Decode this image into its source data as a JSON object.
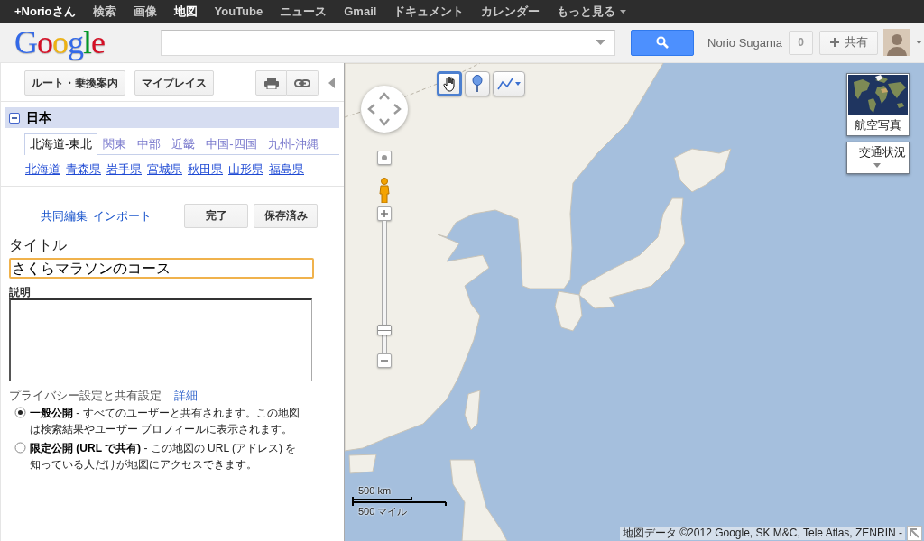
{
  "top_bar": {
    "profile_link": "+Norioさん",
    "items": [
      {
        "label": "検索",
        "selected": false
      },
      {
        "label": "画像",
        "selected": false
      },
      {
        "label": "地図",
        "selected": true
      },
      {
        "label": "YouTube",
        "selected": false
      },
      {
        "label": "ニュース",
        "selected": false
      },
      {
        "label": "Gmail",
        "selected": false
      },
      {
        "label": "ドキュメント",
        "selected": false
      },
      {
        "label": "カレンダー",
        "selected": false
      }
    ],
    "more_menu": "もっと見る"
  },
  "header": {
    "logo": "Google",
    "account": {
      "name": "Norio Sugama",
      "notification_count": "0",
      "share_button": "共有"
    }
  },
  "left_panel": {
    "buttons": [
      "ルート・乗換案内",
      "マイプレイス"
    ],
    "region": {
      "title": "日本",
      "expanded": true,
      "tabs": [
        {
          "label": "北海道-東北",
          "selected": true
        },
        {
          "label": "関東",
          "selected": false
        },
        {
          "label": "中部",
          "selected": false
        },
        {
          "label": "近畿",
          "selected": false
        },
        {
          "label": "中国-四国",
          "selected": false
        },
        {
          "label": "九州-沖縄",
          "selected": false
        }
      ],
      "prefectures": [
        "北海道",
        "青森県",
        "岩手県",
        "宮城県",
        "秋田県",
        "山形県",
        "福島県"
      ]
    },
    "edit": {
      "links": [
        "共同編集",
        "インポート"
      ],
      "buttons": [
        "完了",
        "保存済み"
      ],
      "title_label": "タイトル",
      "title_value": "さくらマラソンのコース",
      "description_label": "説明",
      "privacy_label": "プライバシー設定と共有設定",
      "privacy_link": "詳細",
      "privacy_options": [
        {
          "text": "**一般公開** - すべてのユーザーと共有されます。この地図は検索結果やユーザー プロフィールに表示されます。",
          "selected": true
        },
        {
          "text": "**限定公開 (URL で共有)** - この地図の URL (アドレス) を知っている人だけが地図にアクセスできます。",
          "selected": false
        }
      ]
    }
  },
  "map": {
    "tools": [
      {
        "kind": "hand",
        "selected": true
      },
      {
        "kind": "marker",
        "selected": false
      },
      {
        "kind": "line",
        "selected": false
      }
    ],
    "zoom": {
      "level": 0.15
    },
    "layers": [
      {
        "kind": "satellite",
        "label": "航空写真"
      },
      {
        "kind": "traffic",
        "label": "交通状況"
      }
    ],
    "scale": {
      "metric": "500 km",
      "imperial": "500 マイル"
    },
    "attribution": "地図データ ©2012 Google, SK M&C, Tele Atlas, ZENRIN -"
  }
}
